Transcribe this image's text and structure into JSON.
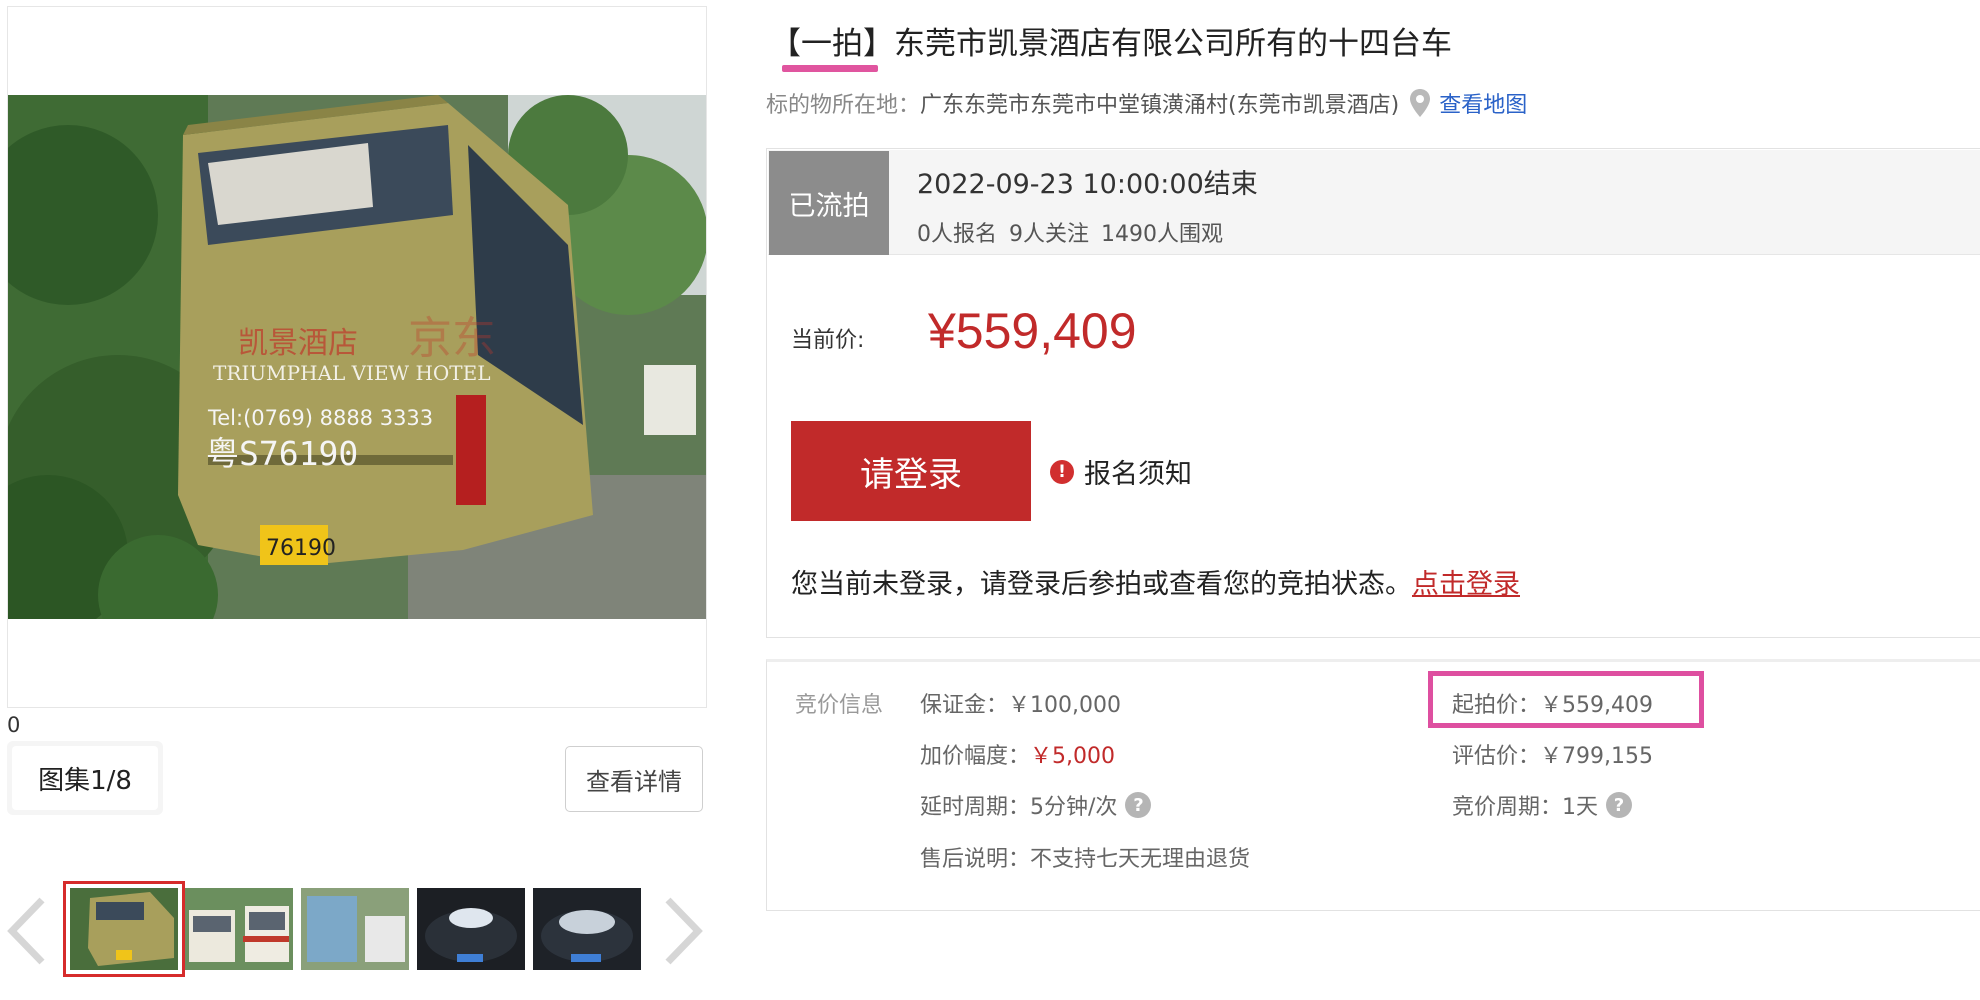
{
  "gallery": {
    "image_index": "0",
    "counter": "图集1/8",
    "view_detail": "查看详情",
    "photo_overlay": {
      "hotel_cn": "凯景酒店",
      "hotel_en": "TRIUMPHAL VIEW HOTEL",
      "tel": "Tel:(0769) 8888 3333",
      "fleet_no": "粤S76190",
      "plate": "76190",
      "watermark": "京东"
    }
  },
  "title": {
    "text": "【一拍】东莞市凯景酒店有限公司所有的十四台车"
  },
  "location": {
    "label": "标的物所在地：",
    "value": "广东东莞市东莞市中堂镇潢涌村(东莞市凯景酒店)",
    "map_link": "查看地图"
  },
  "status": {
    "badge": "已流拍",
    "end_time": "2022-09-23 10:00:00结束",
    "signups": "0人报名",
    "followers": "9人关注",
    "viewers": "1490人围观"
  },
  "price": {
    "label": "当前价:",
    "value": "¥559,409"
  },
  "actions": {
    "login_button": "请登录",
    "notice": "报名须知",
    "tip": "您当前未登录，请登录后参拍或查看您的竞拍状态。",
    "login_link": "点击登录"
  },
  "bid_info": {
    "section_label": "竞价信息",
    "deposit_label": "保证金：",
    "deposit_value": "￥100,000",
    "increment_label": "加价幅度：",
    "increment_value": "￥5,000",
    "delay_label": "延时周期：",
    "delay_value": "5分钟/次",
    "aftersale_label": "售后说明：",
    "aftersale_value": "不支持七天无理由退货",
    "start_price_label": "起拍价：",
    "start_price_value": "￥559,409",
    "appraisal_label": "评估价：",
    "appraisal_value": "￥799,155",
    "bid_period_label": "竞价周期：",
    "bid_period_value": "1天"
  },
  "colors": {
    "accent_red": "#c12a2a",
    "highlight_pink": "#de4fa0",
    "link_blue": "#2a62c8",
    "status_grey": "#8c8c8c"
  }
}
